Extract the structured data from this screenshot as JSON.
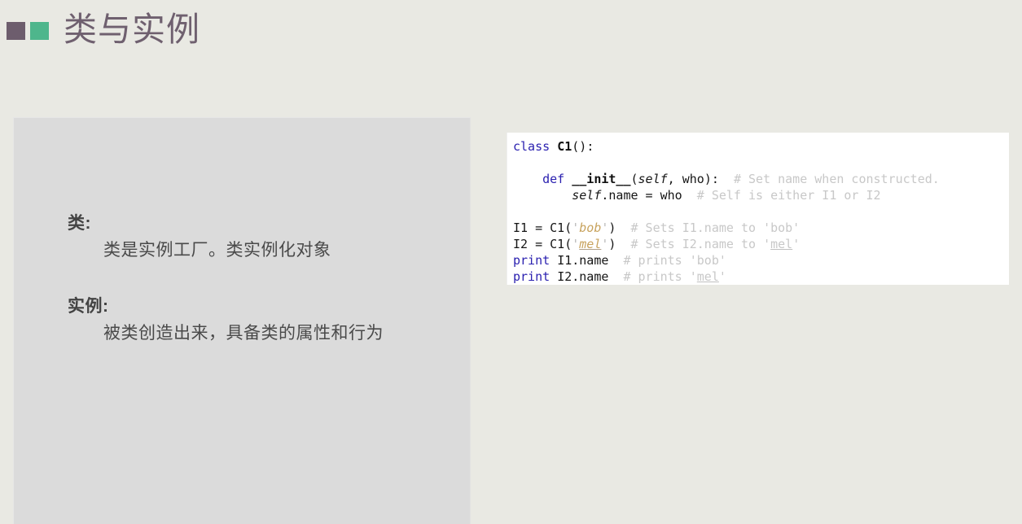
{
  "header": {
    "title": "类与实例",
    "logo_squares": [
      {
        "name": "purple",
        "color": "#6d5d6d"
      },
      {
        "name": "green",
        "color": "#4eb68c"
      }
    ]
  },
  "content_panel": {
    "definitions": [
      {
        "term": "类:",
        "description": "类是实例工厂。类实例化对象"
      },
      {
        "term": "实例:",
        "description": "被类创造出来，具备类的属性和行为"
      }
    ]
  },
  "code_panel": {
    "language": "python",
    "lines": [
      "class C1():",
      "",
      "    def __init__(self, who):  # Set name when constructed.",
      "        self.name = who  # Self is either I1 or I2",
      "",
      "I1 = C1('bob')  # Sets I1.name to 'bob'",
      "I2 = C1('mel')  # Sets I2.name to 'mel'",
      "print I1.name  # prints 'bob'",
      "print I2.name  # prints 'mel'"
    ],
    "tokens": {
      "kw_class": "class",
      "kw_def": "def",
      "kw_print": "print",
      "name_c1": "C1",
      "name_init": "__init__",
      "name_self": "self",
      "name_who": "who",
      "str_bob": "bob",
      "str_mel": "mel",
      "comment_1": "# Set name when constructed.",
      "comment_2": "# Self is either I1 or I2",
      "comment_3a": "# Sets I1.name to ",
      "comment_3b": "'bob'",
      "comment_4a": "# Sets I2.name to ",
      "comment_4b_q1": "'",
      "comment_4b": "mel",
      "comment_4b_q2": "'",
      "comment_5a": "# prints ",
      "comment_5b": "'bob'",
      "comment_6a": "# prints ",
      "comment_6b_q1": "'",
      "comment_6b": "mel",
      "comment_6b_q2": "'",
      "p_paren_open": "(",
      "p_paren_close": ")",
      "p_paren_empty": "()",
      "p_colon": ":",
      "p_comma": ", ",
      "p_quote": "'",
      "p_dot_name": ".name",
      "p_eq": " = ",
      "p_i1": "I1",
      "p_i2": "I2",
      "p_space": " ",
      "p_indent4": "    ",
      "p_indent8": "        ",
      "p_two_sp": "  "
    }
  },
  "colors": {
    "page_background": "#e9e9e3",
    "panel_background": "#dbdbdb",
    "code_background": "#ffffff",
    "title_text": "#6f606f",
    "keyword": "#2b21b0",
    "string": "#c8a35e",
    "comment": "#c8c8c8"
  }
}
